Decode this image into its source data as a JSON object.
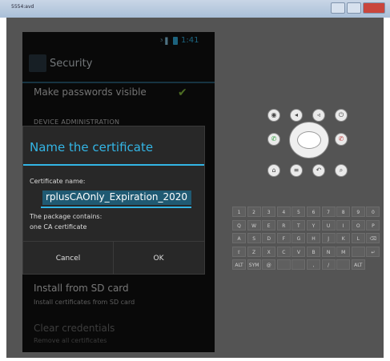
{
  "window": {
    "title": "5554:avd",
    "controls": [
      "minimize",
      "maximize",
      "close"
    ]
  },
  "phone": {
    "status": {
      "signal_glyph": "³▐",
      "time": "1:41"
    },
    "action_bar": {
      "title": "Security",
      "icon": "settings-icon"
    },
    "pref_make_passwords_visible": "Make passwords visible",
    "pref_make_passwords_visible_checked": true,
    "section_device_admin": "DEVICE ADMINISTRATION",
    "dialog": {
      "title": "Name the certificate",
      "label": "Certificate name:",
      "input_value": "rplusCAOnly_Expiration_2020",
      "info_line1": "The package contains:",
      "info_line2": "one CA certificate",
      "cancel": "Cancel",
      "ok": "OK"
    },
    "install_title": "Install from SD card",
    "install_sub": "Install certificates from SD card",
    "clear_title": "Clear credentials",
    "clear_sub": "Remove all certificates"
  },
  "emulator_controls": {
    "top_row": [
      "camera-icon",
      "volume-down-icon",
      "volume-up-icon",
      "power-icon"
    ],
    "mid_row": [
      "call-icon",
      "dpad",
      "end-call-icon"
    ],
    "bottom_row": [
      "home-icon",
      "menu-icon",
      "back-icon",
      "search-icon"
    ]
  },
  "keyboard": {
    "row1": [
      "1",
      "2",
      "3",
      "4",
      "5",
      "6",
      "7",
      "8",
      "9",
      "0"
    ],
    "row2": [
      "Q",
      "W",
      "E",
      "R",
      "T",
      "Y",
      "U",
      "I",
      "O",
      "P"
    ],
    "row3": [
      "A",
      "S",
      "D",
      "F",
      "G",
      "H",
      "J",
      "K",
      "L",
      "⌫"
    ],
    "row4": [
      "⇧",
      "Z",
      "X",
      "C",
      "V",
      "B",
      "N",
      "M",
      "",
      "↵"
    ],
    "row5": [
      "ALT",
      "SYM",
      "@",
      "",
      "",
      ",",
      "/",
      "",
      "ALT"
    ]
  },
  "colors": {
    "accent": "#33b5e5",
    "check": "#8dc640",
    "emulator_bg": "#545454"
  }
}
